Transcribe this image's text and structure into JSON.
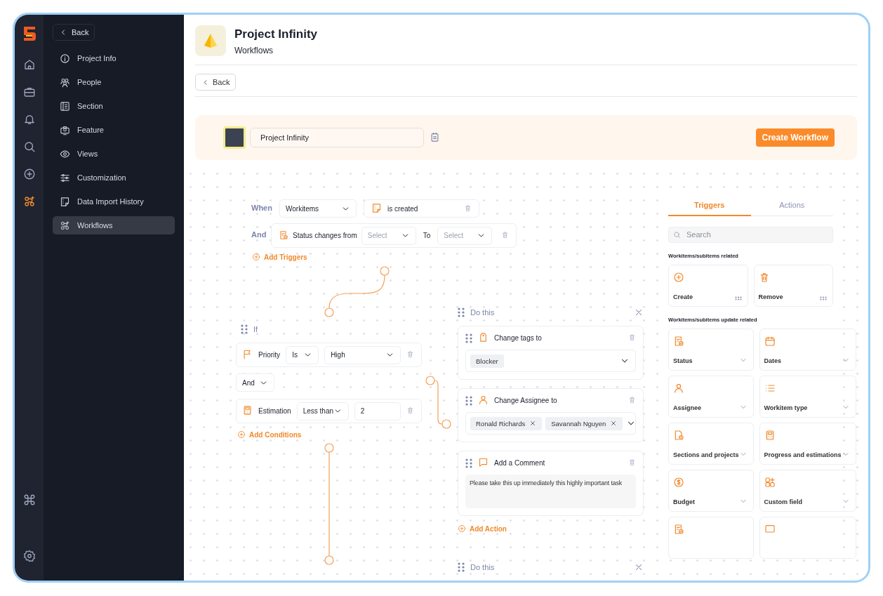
{
  "rail": {
    "items": [
      {
        "selected": false
      },
      {
        "selected": false
      },
      {
        "selected": false
      },
      {
        "selected": false
      },
      {
        "selected": false
      },
      {
        "selected": true
      }
    ],
    "bottom_items": [
      {
        "selected": false
      },
      {
        "selected": false
      }
    ]
  },
  "sidebar": {
    "back": "Back",
    "items": [
      {
        "label": "Project Info",
        "selected": false
      },
      {
        "label": "People",
        "selected": false
      },
      {
        "label": "Section",
        "selected": false
      },
      {
        "label": "Feature",
        "selected": false
      },
      {
        "label": "Views",
        "selected": false
      },
      {
        "label": "Customization",
        "selected": false
      },
      {
        "label": "Data Import History",
        "selected": false
      },
      {
        "label": "Workflows",
        "selected": true
      }
    ]
  },
  "header": {
    "title": "Project Infinity",
    "subtitle": "Workflows",
    "back": "Back"
  },
  "workflow_bar": {
    "name": "Project Infinity",
    "button": "Create Workflow"
  },
  "trigger_block": {
    "when": {
      "label": "When",
      "entity": "Workitems",
      "event": "is created"
    },
    "and": {
      "label": "And",
      "condition": "Status changes from",
      "from_placeholder": "Select",
      "to_label": "To",
      "to_placeholder": "Select"
    },
    "add": "Add Triggers"
  },
  "condition_block": {
    "title": "If",
    "first": {
      "field": "Priority",
      "operator": "Is",
      "value": "High"
    },
    "joiner": "And",
    "second": {
      "field": "Estimation",
      "operator": "Less than",
      "value": "2"
    },
    "add": "Add Conditions"
  },
  "action_groups": [
    {
      "title": "Do this",
      "actions": [
        {
          "title": "Change tags to",
          "kind": "tags",
          "tags": [
            {
              "label": "Blocker",
              "removable": false
            }
          ]
        },
        {
          "title": "Change Assignee to",
          "kind": "tags",
          "tags": [
            {
              "label": "Ronald Richards",
              "removable": true
            },
            {
              "label": "Savannah Nguyen",
              "removable": true
            }
          ]
        },
        {
          "title": "Add a Comment",
          "kind": "comment",
          "text": "Please take this up immediately this highly important task"
        }
      ],
      "add": "Add Action"
    },
    {
      "title": "Do this"
    }
  ],
  "panel": {
    "tabs": [
      {
        "label": "Triggers",
        "selected": true
      },
      {
        "label": "Actions",
        "selected": false
      }
    ],
    "search": {
      "placeholder": "Search"
    },
    "sections": [
      {
        "title": "Workitems/subitems related",
        "items": [
          {
            "label": "Create",
            "kind": "drag"
          },
          {
            "label": "Remove",
            "kind": "drag"
          }
        ]
      },
      {
        "title": "Workitems/subitems update related",
        "items": [
          {
            "label": "Status",
            "kind": "expand"
          },
          {
            "label": "Dates",
            "kind": "expand"
          },
          {
            "label": "Assignee",
            "kind": "expand"
          },
          {
            "label": "Workitem type",
            "kind": "expand"
          },
          {
            "label": "Sections and projects",
            "kind": "expand"
          },
          {
            "label": "Progress and estimations",
            "kind": "expand"
          },
          {
            "label": "Budget",
            "kind": "expand"
          },
          {
            "label": "Custom field",
            "kind": "expand"
          },
          {
            "kind": "cut"
          },
          {
            "kind": "cut"
          }
        ]
      }
    ]
  }
}
